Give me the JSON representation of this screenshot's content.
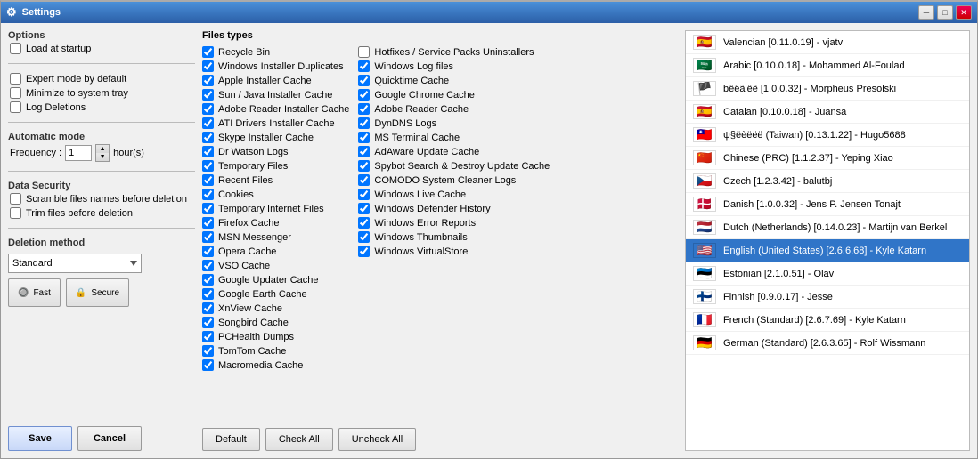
{
  "window": {
    "title": "Settings",
    "controls": {
      "minimize": "─",
      "maximize": "□",
      "close": "✕"
    }
  },
  "left": {
    "options_label": "Options",
    "load_startup": "Load at startup",
    "expert_mode": "Expert mode by default",
    "minimize_tray": "Minimize to system tray",
    "log_deletions": "Log Deletions",
    "automatic_label": "Automatic mode",
    "frequency_label": "Frequency :",
    "frequency_value": "1",
    "hours_label": "hour(s)",
    "security_label": "Data Security",
    "scramble": "Scramble files names before deletion",
    "trim": "Trim files before deletion",
    "deletion_label": "Deletion method",
    "deletion_method": "Standard",
    "fast_label": "Fast",
    "secure_label": "Secure",
    "save_label": "Save",
    "cancel_label": "Cancel"
  },
  "middle": {
    "files_types_label": "Files types",
    "col1": [
      {
        "label": "Recycle Bin",
        "checked": true
      },
      {
        "label": "Windows Installer Duplicates",
        "checked": true
      },
      {
        "label": "Apple Installer Cache",
        "checked": true
      },
      {
        "label": "Sun / Java Installer Cache",
        "checked": true
      },
      {
        "label": "Adobe Reader Installer Cache",
        "checked": true
      },
      {
        "label": "ATI Drivers Installer Cache",
        "checked": true
      },
      {
        "label": "Skype Installer Cache",
        "checked": true
      },
      {
        "label": "Dr Watson Logs",
        "checked": true
      },
      {
        "label": "Temporary Files",
        "checked": true
      },
      {
        "label": "Recent Files",
        "checked": true
      },
      {
        "label": "Cookies",
        "checked": true
      },
      {
        "label": "Temporary Internet Files",
        "checked": true
      },
      {
        "label": "Firefox Cache",
        "checked": true
      },
      {
        "label": "MSN Messenger",
        "checked": true
      },
      {
        "label": "Opera Cache",
        "checked": true
      },
      {
        "label": "VSO Cache",
        "checked": true
      },
      {
        "label": "Google Updater Cache",
        "checked": true
      },
      {
        "label": "Google Earth Cache",
        "checked": true
      },
      {
        "label": "XnView Cache",
        "checked": true
      },
      {
        "label": "Songbird Cache",
        "checked": true
      },
      {
        "label": "PCHealth Dumps",
        "checked": true
      },
      {
        "label": "TomTom Cache",
        "checked": true
      },
      {
        "label": "Macromedia Cache",
        "checked": true
      }
    ],
    "col2": [
      {
        "label": "Hotfixes / Service Packs Uninstallers",
        "checked": false
      },
      {
        "label": "Windows Log files",
        "checked": true
      },
      {
        "label": "Quicktime Cache",
        "checked": true
      },
      {
        "label": "Google Chrome Cache",
        "checked": true
      },
      {
        "label": "Adobe Reader Cache",
        "checked": true
      },
      {
        "label": "DynDNS Logs",
        "checked": true
      },
      {
        "label": "MS Terminal Cache",
        "checked": true
      },
      {
        "label": "AdAware Update Cache",
        "checked": true
      },
      {
        "label": "Spybot Search & Destroy Update Cache",
        "checked": true
      },
      {
        "label": "COMODO System Cleaner Logs",
        "checked": true
      },
      {
        "label": "Windows Live Cache",
        "checked": true
      },
      {
        "label": "Windows Defender History",
        "checked": true
      },
      {
        "label": "Windows Error Reports",
        "checked": true
      },
      {
        "label": "Windows Thumbnails",
        "checked": true
      },
      {
        "label": "Windows VirtualStore",
        "checked": true
      }
    ],
    "buttons": {
      "default": "Default",
      "check_all": "Check All",
      "uncheck_all": "Uncheck All"
    }
  },
  "languages": [
    {
      "flag": "🇪🇸",
      "label": "Valencian [0.11.0.19] - vjatv",
      "selected": false,
      "flag_style": "catalan"
    },
    {
      "flag": "🇸🇦",
      "label": "Arabic [0.10.0.18] - Mohammed Al-Foulad",
      "selected": false,
      "flag_style": "arabic"
    },
    {
      "flag": "🏴",
      "label": "ƃëëã'ëë [1.0.0.32] - Morpheus Presolski",
      "selected": false,
      "flag_style": "custom"
    },
    {
      "flag": "🇪🇸",
      "label": "Catalan [0.10.0.18] - Juansa",
      "selected": false,
      "flag_style": "catalan"
    },
    {
      "flag": "🇹🇼",
      "label": "ψ§ëèëëë (Taiwan) [0.13.1.22] - Hugo5688",
      "selected": false,
      "flag_style": "taiwan"
    },
    {
      "flag": "🇨🇳",
      "label": "Chinese (PRC) [1.1.2.37] - Yeping Xiao",
      "selected": false,
      "flag_style": "china"
    },
    {
      "flag": "🇨🇿",
      "label": "Czech [1.2.3.42] - balutbj",
      "selected": false,
      "flag_style": "czech"
    },
    {
      "flag": "🇩🇰",
      "label": "Danish [1.0.0.32] - Jens P. Jensen Tonajt",
      "selected": false,
      "flag_style": "danish"
    },
    {
      "flag": "🇳🇱",
      "label": "Dutch (Netherlands) [0.14.0.23] - Martijn van Berkel",
      "selected": false,
      "flag_style": "dutch"
    },
    {
      "flag": "🇺🇸",
      "label": "English (United States) [2.6.6.68] - Kyle Katarn",
      "selected": true,
      "flag_style": "us"
    },
    {
      "flag": "🇪🇪",
      "label": "Estonian [2.1.0.51] - Olav",
      "selected": false,
      "flag_style": "estonian"
    },
    {
      "flag": "🇫🇮",
      "label": "Finnish [0.9.0.17] - Jesse",
      "selected": false,
      "flag_style": "finnish"
    },
    {
      "flag": "🇫🇷",
      "label": "French (Standard) [2.6.7.69] - Kyle Katarn",
      "selected": false,
      "flag_style": "french"
    },
    {
      "flag": "🇩🇪",
      "label": "German (Standard) [2.6.3.65] - Rolf Wissmann",
      "selected": false,
      "flag_style": "german"
    }
  ]
}
